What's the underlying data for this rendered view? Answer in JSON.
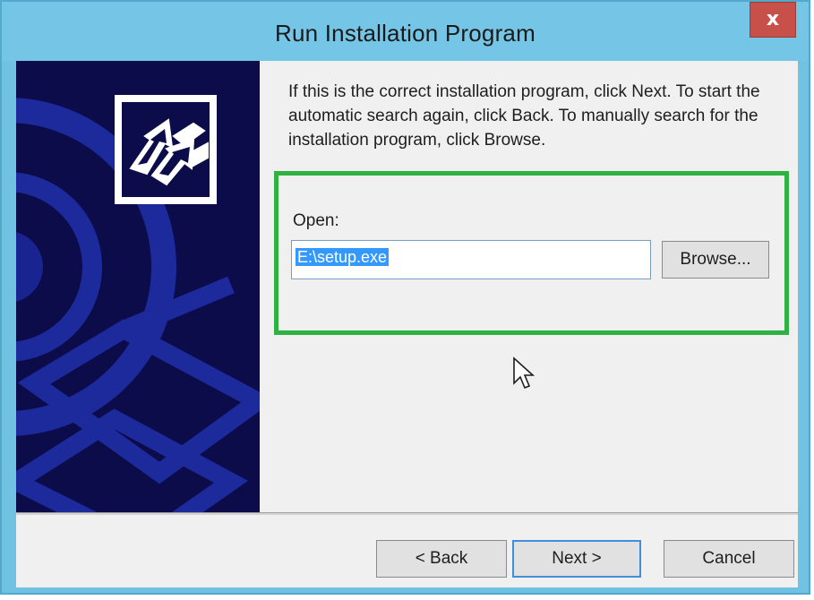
{
  "window": {
    "title": "Run Installation Program",
    "close_label": "x"
  },
  "content": {
    "description": "If this is the correct installation program, click Next. To start the automatic search again, click Back. To manually search for the installation program, click Browse.",
    "open_label": "Open:",
    "open_value": "E:\\setup.exe",
    "browse_label": "Browse..."
  },
  "footer": {
    "back_label": "< Back",
    "next_label": "Next >",
    "cancel_label": "Cancel"
  },
  "colors": {
    "titlebar": "#75c6e6",
    "close_button": "#c7514a",
    "side_art": "#0c0c4a",
    "highlight_box": "#2fb143",
    "selection": "#3399ff"
  },
  "icons": {
    "side_logo": "install-arrow-icon",
    "cursor": "mouse-cursor-icon"
  }
}
